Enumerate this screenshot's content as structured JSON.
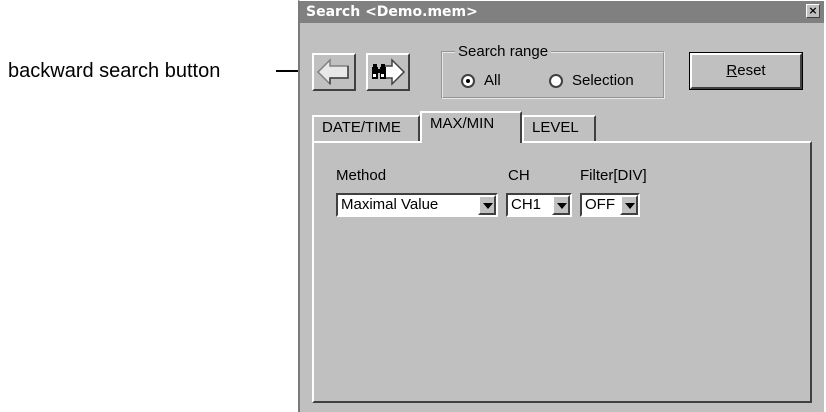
{
  "callout": {
    "text": "backward search button"
  },
  "window": {
    "title": "Search <Demo.mem>",
    "close": "×"
  },
  "toolbar": {
    "back_icon": "arrow-left-icon",
    "forward_icon": "binoculars-forward-icon"
  },
  "search_range": {
    "legend": "Search range",
    "options": [
      {
        "label": "All",
        "selected": true
      },
      {
        "label": "Selection",
        "selected": false
      }
    ]
  },
  "reset_button": {
    "label_underlined": "R",
    "label_rest": "eset"
  },
  "tabs": [
    {
      "label": "DATE/TIME",
      "active": false
    },
    {
      "label": "MAX/MIN",
      "active": true
    },
    {
      "label": "LEVEL",
      "active": false
    }
  ],
  "fields": {
    "method": {
      "label": "Method",
      "value": "Maximal Value"
    },
    "ch": {
      "label": "CH",
      "value": "CH1"
    },
    "filter": {
      "label": "Filter[DIV]",
      "value": "OFF"
    }
  }
}
